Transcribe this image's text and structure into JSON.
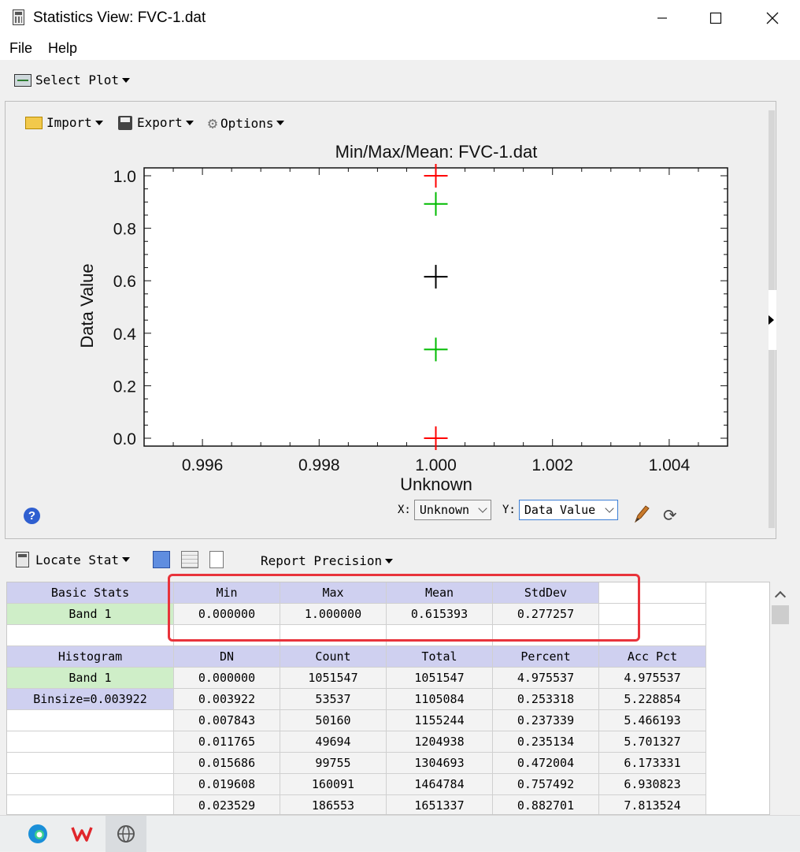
{
  "window": {
    "title": "Statistics View: FVC-1.dat"
  },
  "menu": {
    "file": "File",
    "help": "Help"
  },
  "toolbar": {
    "select_plot": "Select Plot"
  },
  "plot_toolbar": {
    "import": "Import",
    "export": "Export",
    "options": "Options"
  },
  "chart_data": {
    "type": "scatter",
    "title": "Min/Max/Mean: FVC-1.dat",
    "xlabel": "Unknown",
    "ylabel": "Data Value",
    "xlim": [
      0.995,
      1.005
    ],
    "ylim": [
      -0.03,
      1.03
    ],
    "x_ticks": [
      "0.996",
      "0.998",
      "1.000",
      "1.002",
      "1.004"
    ],
    "y_ticks": [
      "0.0",
      "0.2",
      "0.4",
      "0.6",
      "0.8",
      "1.0"
    ],
    "grid": false,
    "colors": {
      "minmax": "#ff0000",
      "stddev": "#00bb00",
      "mean": "#000000"
    },
    "points": [
      {
        "x": 1.0,
        "y": 1.0,
        "kind": "minmax"
      },
      {
        "x": 1.0,
        "y": 0.0,
        "kind": "minmax"
      },
      {
        "x": 1.0,
        "y": 0.89265,
        "kind": "stddev"
      },
      {
        "x": 1.0,
        "y": 0.338136,
        "kind": "stddev"
      },
      {
        "x": 1.0,
        "y": 0.615393,
        "kind": "mean"
      }
    ]
  },
  "axis_selectors": {
    "x_label": "X:",
    "x_value": "Unknown",
    "y_label": "Y:",
    "y_value": "Data Value"
  },
  "stats_toolbar": {
    "locate_stat": "Locate Stat",
    "report_precision": "Report Precision"
  },
  "basic_stats": {
    "header": "Basic Stats",
    "columns": [
      "Min",
      "Max",
      "Mean",
      "StdDev"
    ],
    "band": "Band 1",
    "values": [
      "0.000000",
      "1.000000",
      "0.615393",
      "0.277257"
    ]
  },
  "histogram": {
    "header": "Histogram",
    "columns": [
      "DN",
      "Count",
      "Total",
      "Percent",
      "Acc Pct"
    ],
    "band": "Band 1",
    "binsize": "Binsize=0.003922",
    "rows": [
      [
        "0.000000",
        "1051547",
        "1051547",
        "4.975537",
        "4.975537"
      ],
      [
        "0.003922",
        "53537",
        "1105084",
        "0.253318",
        "5.228854"
      ],
      [
        "0.007843",
        "50160",
        "1155244",
        "0.237339",
        "5.466193"
      ],
      [
        "0.011765",
        "49694",
        "1204938",
        "0.235134",
        "5.701327"
      ],
      [
        "0.015686",
        "99755",
        "1304693",
        "0.472004",
        "6.173331"
      ],
      [
        "0.019608",
        "160091",
        "1464784",
        "0.757492",
        "6.930823"
      ],
      [
        "0.023529",
        "186553",
        "1651337",
        "0.882701",
        "7.813524"
      ]
    ]
  }
}
